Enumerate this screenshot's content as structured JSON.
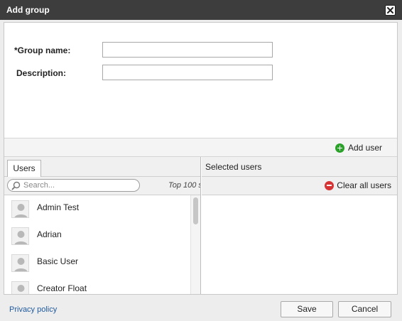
{
  "dialog": {
    "title": "Add group",
    "close_icon": "close-icon"
  },
  "form": {
    "group_name_label": "*Group name:",
    "group_name_value": "",
    "description_label": "Description:",
    "description_value": ""
  },
  "toolbar": {
    "add_user_label": "Add user",
    "add_user_icon": "plus-circle-icon",
    "add_user_color": "#2aa22a"
  },
  "users_panel": {
    "tab_label": "Users",
    "search_placeholder": "Search...",
    "search_icon": "search-icon",
    "top_label": "Top 100 s",
    "users": [
      {
        "name": "Admin Test",
        "icon": "user-avatar-icon"
      },
      {
        "name": "Adrian",
        "icon": "user-avatar-icon"
      },
      {
        "name": "Basic User",
        "icon": "user-avatar-icon"
      },
      {
        "name": "Creator Float",
        "icon": "user-avatar-icon"
      }
    ]
  },
  "selected_panel": {
    "header": "Selected users",
    "clear_all_label": "Clear all users",
    "clear_all_icon": "minus-circle-icon",
    "clear_all_color": "#d63434"
  },
  "footer": {
    "privacy_label": "Privacy policy",
    "save_label": "Save",
    "cancel_label": "Cancel"
  }
}
